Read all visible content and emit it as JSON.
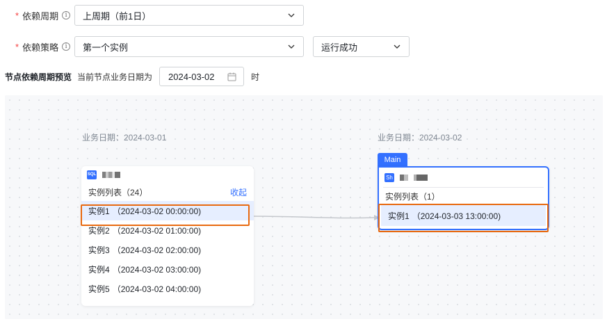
{
  "form": {
    "period": {
      "label": "依赖周期",
      "value": "上周期（前1日）"
    },
    "strategy": {
      "label": "依赖策略",
      "value": "第一个实例",
      "status_value": "运行成功"
    },
    "required_mark": "*",
    "info_glyph": "i"
  },
  "preview": {
    "title": "节点依赖周期预览",
    "subtitle": "当前节点业务日期为",
    "date": "2024-03-02",
    "suffix": "时"
  },
  "upstream": {
    "date_caption": "业务日期：2024-03-01",
    "node_type": "SQL",
    "list_title": "实例列表（24）",
    "collapse_label": "收起",
    "instances": [
      {
        "name": "实例1",
        "time": "（2024-03-02 00:00:00)"
      },
      {
        "name": "实例2",
        "time": "（2024-03-02 01:00:00)"
      },
      {
        "name": "实例3",
        "time": "（2024-03-02 02:00:00)"
      },
      {
        "name": "实例4",
        "time": "（2024-03-02 03:00:00)"
      },
      {
        "name": "实例5",
        "time": "（2024-03-02 04:00:00)"
      }
    ]
  },
  "downstream": {
    "date_caption": "业务日期：2024-03-02",
    "tag": "Main",
    "node_type": "Sh",
    "list_title": "实例列表（1）",
    "instances": [
      {
        "name": "实例1",
        "time": "（2024-03-03 13:00:00)"
      }
    ]
  },
  "colors": {
    "accent": "#3370ff",
    "highlight": "#e8690f",
    "required": "#f53f3f",
    "selected_row": "#e6eeff"
  }
}
